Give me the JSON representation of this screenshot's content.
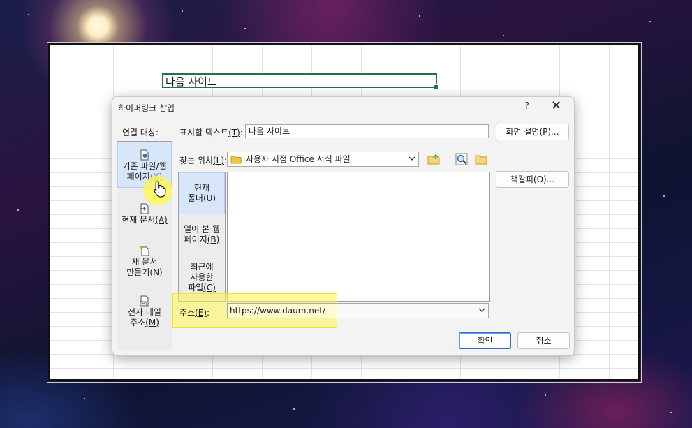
{
  "sheet": {
    "active_cell_text": "다음 사이트"
  },
  "dialog": {
    "title": "하이퍼링크 삽입",
    "help_label": "?",
    "close_label": "✕",
    "link_to_label": "연결 대상:",
    "display_text_label": "표시할 텍스트",
    "display_text_key": "(T)",
    "display_text_value": "다음 사이트",
    "screentip_button": "화면 설명(P)...",
    "look_in_label": "찾는 위치",
    "look_in_key": "(L)",
    "look_in_value": "사용자 지정 Office 서식 파일",
    "bookmark_button": "책갈피(O)...",
    "address_label": "주소",
    "address_key": "(E)",
    "address_value": "https://www.daum.net/",
    "ok_button": "확인",
    "cancel_button": "취소",
    "link_bar": [
      {
        "line1": "기존 파일/웹",
        "line2": "페이지",
        "key": "(X)",
        "icon": "existing-file-icon",
        "selected": true
      },
      {
        "line1": "현재 문서",
        "key": "(A)",
        "icon": "current-document-icon",
        "selected": false
      },
      {
        "line1": "새 문서",
        "line2": "만들기",
        "key": "(N)",
        "icon": "new-document-icon",
        "selected": false
      },
      {
        "line1": "전자 메일",
        "line2": "주소",
        "key": "(M)",
        "icon": "email-icon",
        "selected": false
      }
    ],
    "places": [
      {
        "line1": "현재",
        "line2": "폴더",
        "key": "(U)",
        "selected": true
      },
      {
        "line1": "열어 본 웹",
        "line2": "페이지",
        "key": "(B)",
        "selected": false
      },
      {
        "line1": "최근에",
        "line2": "사용한",
        "line3": "파일",
        "key": "(C)",
        "selected": false
      }
    ]
  },
  "colors": {
    "accent": "#217346",
    "highlight": "#fff550",
    "selection": "#d7e6f8"
  }
}
